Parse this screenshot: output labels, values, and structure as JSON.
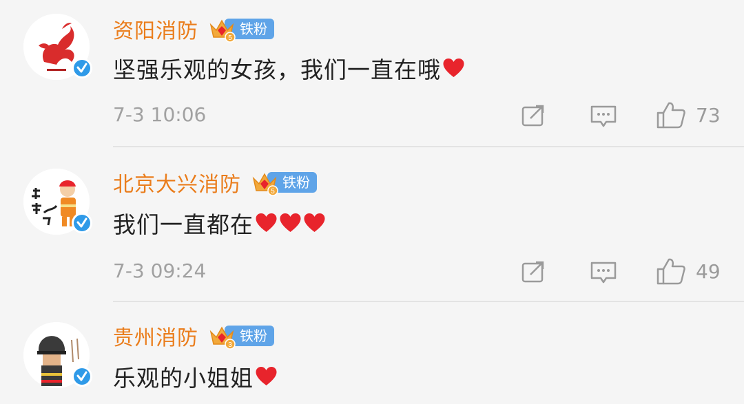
{
  "comments": [
    {
      "username": "资阳消防",
      "badge": {
        "level": "5",
        "label": "铁粉"
      },
      "text": "坚强乐观的女孩，我们一直在哦",
      "hearts": 1,
      "timestamp": "7-3 10:06",
      "likes": "73"
    },
    {
      "username": "北京大兴消防",
      "badge": {
        "level": "5",
        "label": "铁粉"
      },
      "text": "我们一直都在",
      "hearts": 3,
      "timestamp": "7-3 09:24",
      "likes": "49"
    },
    {
      "username": "贵州消防",
      "badge": {
        "level": "3",
        "label": "铁粉"
      },
      "text": "乐观的小姐姐",
      "hearts": 1
    }
  ],
  "colors": {
    "username": "#ea7d1c",
    "badge_blue": "#5fa4e8",
    "heart_red": "#e8242c",
    "verified_blue": "#2f9ae8",
    "meta_gray": "#a1a1a1",
    "background": "#f5f5f5"
  },
  "icons": [
    "repost-icon",
    "comment-icon",
    "like-icon",
    "verified-icon",
    "heart-icon",
    "crown-badge-icon"
  ]
}
